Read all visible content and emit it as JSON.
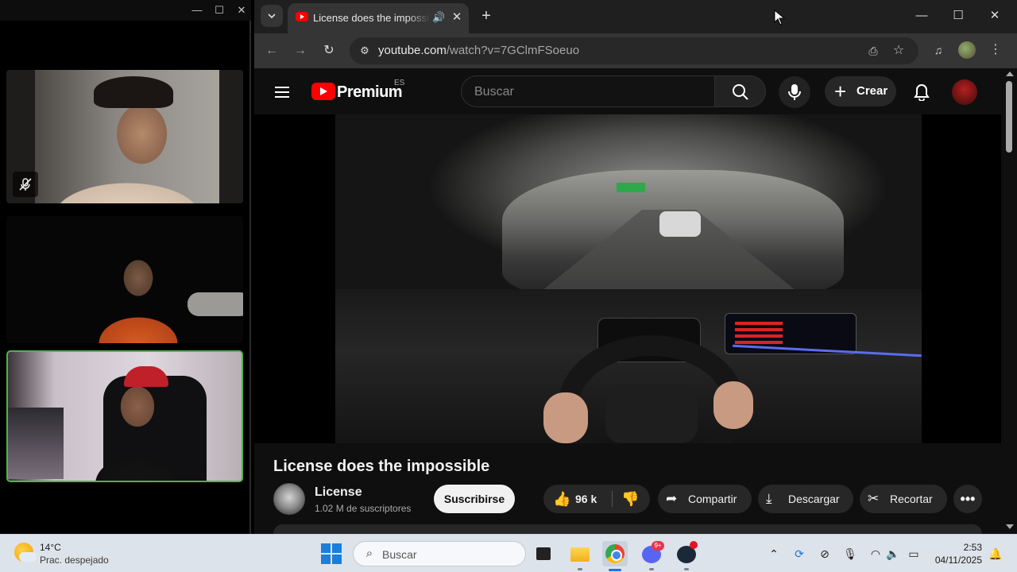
{
  "call_window": {
    "controls": {
      "minimize": "—",
      "maximize": "☐",
      "close": "✕"
    },
    "mute_icon": "mic-off-icon"
  },
  "browser": {
    "tab": {
      "title": "License does the impossible",
      "favicon": "youtube-favicon",
      "audio_icon": "🔊",
      "close": "✕"
    },
    "new_tab": "+",
    "window_controls": {
      "minimize": "—",
      "maximize": "☐",
      "close": "✕"
    },
    "toolbar": {
      "back": "←",
      "forward": "→",
      "reload": "↻",
      "site_info": "⚙",
      "install": "⎙",
      "star": "☆",
      "media": "♫",
      "menu": "⋮"
    },
    "url": {
      "domain": "youtube.com",
      "path": "/watch?v=7GClmFSoeuo"
    }
  },
  "youtube": {
    "brand": "Premium",
    "country": "ES",
    "search_placeholder": "Buscar",
    "search_icon": "⌕",
    "mic_icon": "🎙",
    "create_label": "Crear",
    "create_plus": "+",
    "bell_icon": "🔔",
    "video": {
      "title": "License does the impossible",
      "channel": "License",
      "subscribers": "1.02 M de suscriptores",
      "subscribe_label": "Suscribirse",
      "likes": "96 k",
      "like_icon": "👍",
      "dislike_icon": "👎",
      "share_label": "Compartir",
      "share_icon": "➦",
      "download_label": "Descargar",
      "download_icon": "⤓",
      "clip_label": "Recortar",
      "clip_icon": "✂",
      "more_icon": "•••"
    }
  },
  "taskbar": {
    "weather": {
      "temp": "14°C",
      "desc": "Prac. despejado"
    },
    "search_label": "Buscar",
    "search_icon": "⌕",
    "discord_badge": "9+",
    "tray": {
      "chevron": "⌃",
      "sync": "⟳",
      "network_off": "⊘",
      "mic": "🎙",
      "wifi": "◠",
      "volume": "🔈",
      "battery": "▭"
    },
    "clock": {
      "time": "2:53",
      "date": "04/11/2025"
    },
    "notify_icon": "🔔"
  }
}
